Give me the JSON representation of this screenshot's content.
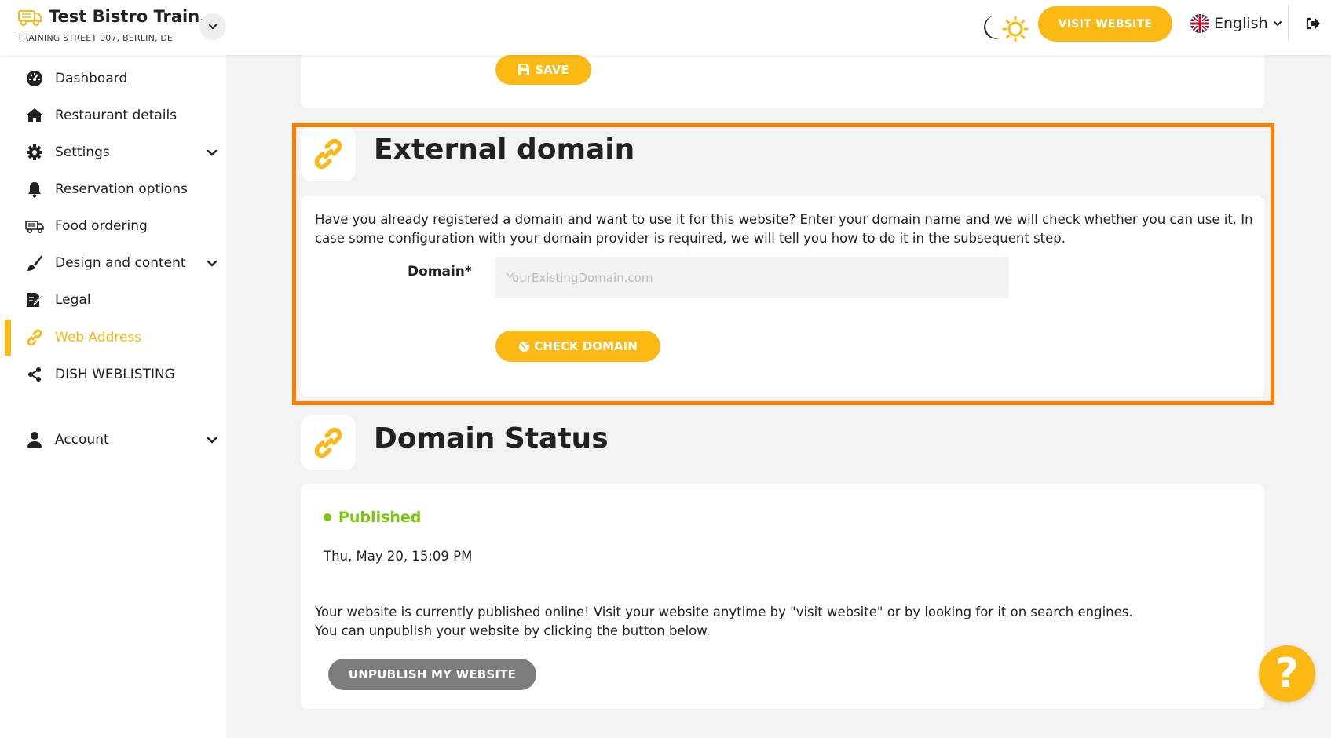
{
  "header": {
    "restaurant_name": "Test Bistro Train...",
    "address": "TRAINING STREET 007, BERLIN, DE",
    "visit_website_label": "VISIT WEBSITE",
    "language": "English"
  },
  "sidebar": {
    "items": [
      {
        "label": "Dashboard",
        "icon": "dashboard-icon"
      },
      {
        "label": "Restaurant details",
        "icon": "home-icon"
      },
      {
        "label": "Settings",
        "icon": "gear-icon"
      },
      {
        "label": "Reservation options",
        "icon": "bell-icon"
      },
      {
        "label": "Food ordering",
        "icon": "food-ordering-icon"
      },
      {
        "label": "Design and content",
        "icon": "brush-icon"
      },
      {
        "label": "Legal",
        "icon": "legal-icon"
      },
      {
        "label": "Web Address",
        "icon": "link-icon"
      },
      {
        "label": "DISH WEBLISTING",
        "icon": "share-icon"
      },
      {
        "label": "Account",
        "icon": "user-icon"
      }
    ],
    "active": "Web Address"
  },
  "main": {
    "save_label": "SAVE",
    "external_domain": {
      "title": "External domain",
      "description": "Have you already registered a domain and want to use it for this website? Enter your domain name and we will check whether you can use it. In case some configuration with your domain provider is required, we will tell you how to do it in the subsequent step.",
      "domain_label": "Domain*",
      "domain_value": "",
      "domain_placeholder": "YourExistingDomain.com",
      "check_label": "CHECK DOMAIN"
    },
    "domain_status": {
      "title": "Domain Status",
      "status": "Published",
      "date": "Thu, May 20, 15:09 PM",
      "info_line1": "Your website is currently published online! Visit your website anytime by \"visit website\" or by looking for it on search engines.",
      "info_line2": "You can unpublish your website by clicking the button below.",
      "unpublish_label": "UNPUBLISH MY WEBSITE"
    }
  },
  "colors": {
    "accent": "#fdb913",
    "highlight": "#ff7f00",
    "published": "#7ac70c",
    "unpublish_button": "#7d7d7d"
  }
}
